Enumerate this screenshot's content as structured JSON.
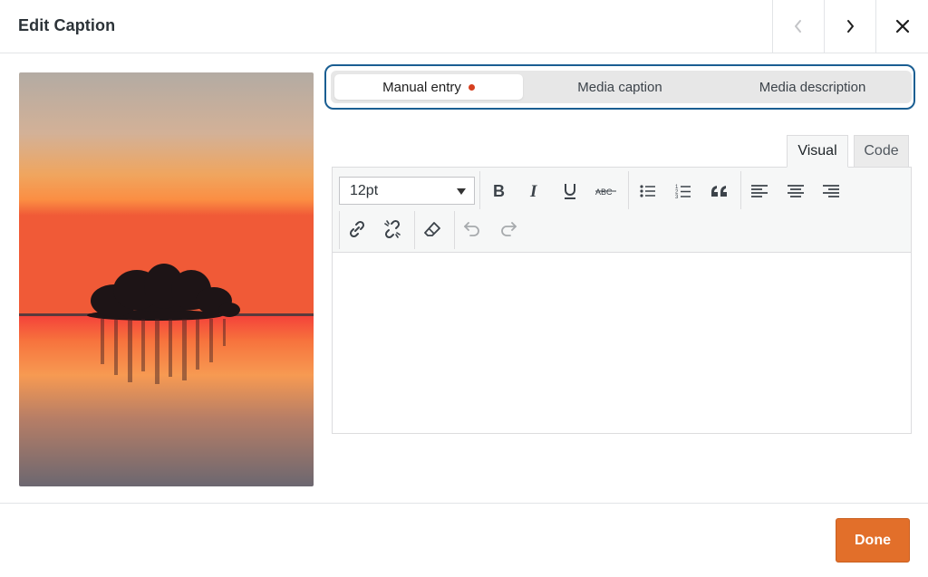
{
  "modal": {
    "title": "Edit Caption",
    "nav": {
      "prev_icon": "chevron-left-icon",
      "next_icon": "chevron-right-icon",
      "close_icon": "close-icon"
    }
  },
  "image": {
    "subject": "sunset-island"
  },
  "caption_source_tabs": [
    {
      "label": "Manual entry",
      "active": true,
      "indicator": true
    },
    {
      "label": "Media caption",
      "active": false
    },
    {
      "label": "Media description",
      "active": false
    }
  ],
  "editor": {
    "modes": {
      "visual": "Visual",
      "code": "Code",
      "active": "Visual"
    },
    "font_size": "12pt",
    "toolbar_row1": [
      "bold-icon",
      "italic-icon",
      "underline-icon",
      "strikethrough-icon",
      "bulleted-list-icon",
      "numbered-list-icon",
      "blockquote-icon",
      "align-left-icon",
      "align-center-icon",
      "align-right-icon"
    ],
    "toolbar_row2": [
      "link-icon",
      "unlink-icon",
      "clear-formatting-icon",
      "undo-icon",
      "redo-icon"
    ],
    "content": ""
  },
  "footer": {
    "done_label": "Done"
  },
  "colors": {
    "accent_orange": "#e26f2a",
    "focus_outline": "#1a5e92",
    "indicator_dot": "#d63f1f"
  }
}
